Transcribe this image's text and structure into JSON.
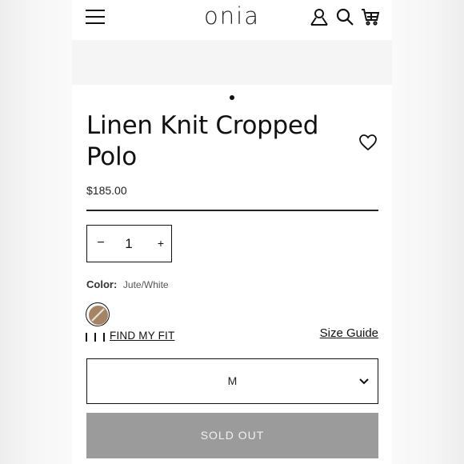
{
  "header": {
    "logo": "onia",
    "icons": [
      "menu-icon",
      "account-icon",
      "search-icon",
      "cart-icon"
    ]
  },
  "product": {
    "title": "Linen Knit Cropped Polo",
    "price": "$185.00",
    "quantity": {
      "minus": "−",
      "value": "1",
      "plus": "+"
    },
    "color": {
      "label": "Color:",
      "value": "Jute/White",
      "swatch_colors": [
        "#a48465",
        "#e8e2d8"
      ]
    },
    "fit": {
      "find_my_fit": "FIND MY FIT",
      "size_guide": "Size Guide"
    },
    "size": {
      "selected": "M"
    },
    "sold_out_label": "SOLD OUT"
  },
  "colors": {
    "sold_out_bg": "#9b9b9b",
    "image_band_bg": "#f5f5f5"
  }
}
